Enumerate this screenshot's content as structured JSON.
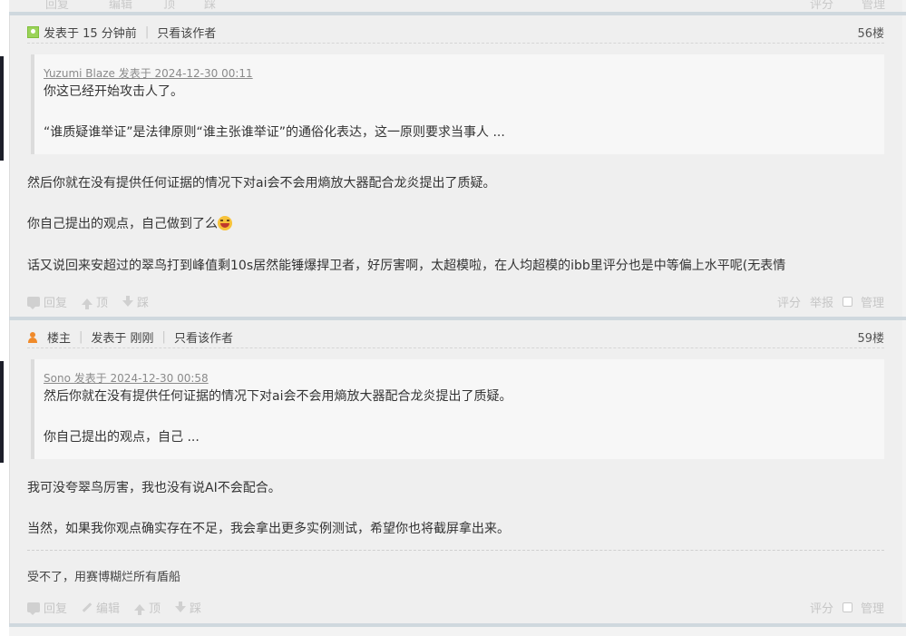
{
  "top_actions": {
    "reply": "回复",
    "edit": "编辑",
    "up": "顶",
    "down": "踩",
    "rate": "评分",
    "manage": "管理"
  },
  "posts": [
    {
      "header": {
        "posted": "发表于 15 分钟前",
        "only_author": "只看该作者",
        "floor": "56楼"
      },
      "quote": {
        "meta": "Yuzumi Blaze 发表于 2024-12-30 00:11",
        "lines": [
          "你这已经开始攻击人了。",
          "“谁质疑谁举证”是法律原则“谁主张谁举证”的通俗化表达，这一原则要求当事人 ..."
        ]
      },
      "body": [
        "然后你就在没有提供任何证据的情况下对ai会不会用熵放大器配合龙炎提出了质疑。",
        "你自己提出的观点，自己做到了么",
        "话又说回来安超过的翠鸟打到峰值剩10s居然能锤爆捍卫者，好厉害啊，太超模啦，在人均超模的ibb里评分也是中等偏上水平呢(无表情"
      ],
      "actions": {
        "reply": "回复",
        "up": "顶",
        "down": "踩",
        "rate": "评分",
        "report": "举报",
        "manage": "管理"
      }
    },
    {
      "header": {
        "host": "楼主",
        "posted": "发表于 刚刚",
        "only_author": "只看该作者",
        "floor": "59楼"
      },
      "quote": {
        "meta": "Sono 发表于 2024-12-30 00:58",
        "lines": [
          "然后你就在没有提供任何证据的情况下对ai会不会用熵放大器配合龙炎提出了质疑。",
          "你自己提出的观点，自己 ..."
        ]
      },
      "body": [
        "我可没夸翠鸟厉害，我也没有说AI不会配合。",
        "当然，如果我你观点确实存在不足，我会拿出更多实例测试，希望你也将截屏拿出来。"
      ],
      "signature": "受不了，用赛博糊烂所有盾船",
      "actions": {
        "reply": "回复",
        "edit": "编辑",
        "up": "顶",
        "down": "踩",
        "rate": "评分",
        "manage": "管理"
      }
    }
  ]
}
